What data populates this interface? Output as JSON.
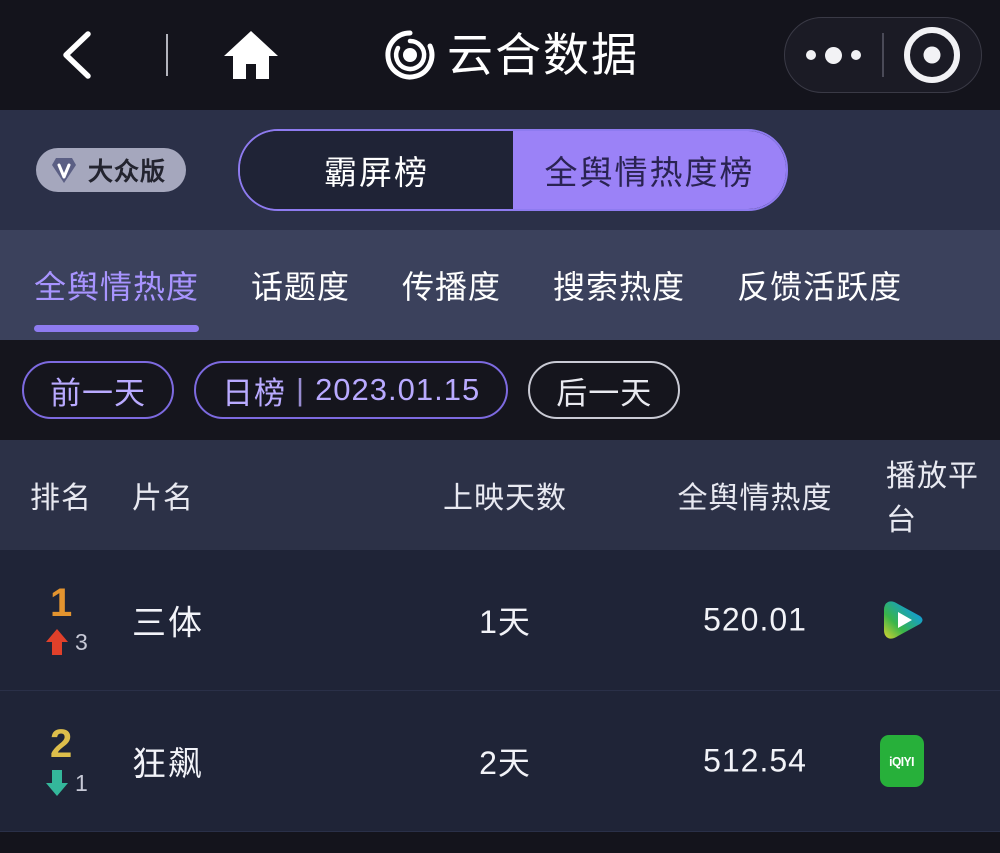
{
  "navbar": {
    "back_icon": "chevron-left-icon",
    "home_icon": "home-icon",
    "logo_icon": "yunhe-swirl-logo-icon",
    "title": "云合数据",
    "capsule": {
      "more_icon": "more-dots-icon",
      "target_icon": "target-ring-icon"
    }
  },
  "version_badge": {
    "icon": "vip-gem-icon",
    "label": "大众版"
  },
  "segmented": {
    "options": [
      {
        "label": "霸屏榜",
        "active": false
      },
      {
        "label": "全舆情热度榜",
        "active": true
      }
    ]
  },
  "tabs": [
    {
      "label": "全舆情热度",
      "active": true
    },
    {
      "label": "话题度",
      "active": false
    },
    {
      "label": "传播度",
      "active": false
    },
    {
      "label": "搜索热度",
      "active": false
    },
    {
      "label": "反馈活跃度",
      "active": false
    }
  ],
  "date_nav": {
    "prev_label": "前一天",
    "period_label": "日榜",
    "separator": "|",
    "date": "2023.01.15",
    "next_label": "后一天"
  },
  "table": {
    "columns": [
      "排名",
      "片名",
      "上映天数",
      "全舆情热度",
      "播放平台"
    ],
    "rows": [
      {
        "rank": "1",
        "rank_color": "#e3942f",
        "trend": "up",
        "trend_icon": "arrow-up-icon",
        "trend_value": "3",
        "trend_color": "#e0402a",
        "title": "三体",
        "days": "1天",
        "heat": "520.01",
        "platform": "youku",
        "platform_icon": "youku-play-icon"
      },
      {
        "rank": "2",
        "rank_color": "#ddbe4b",
        "trend": "down",
        "trend_icon": "arrow-down-icon",
        "trend_value": "1",
        "trend_color": "#34b79b",
        "title": "狂飙",
        "days": "2天",
        "heat": "512.54",
        "platform": "iqiyi",
        "platform_icon": "iqiyi-logo-icon",
        "platform_label": "iQIYI"
      }
    ]
  },
  "colors": {
    "page_background": "#14141c",
    "switch_band": "#2b3048",
    "tab_band": "#3b415c",
    "date_band": "#15151d",
    "table_header": "#2c3147",
    "table_body": "#1f2437",
    "accent_purple": "#8e7bf0",
    "active_segment": "#9b82f7",
    "iqiyi_green": "#27b03a"
  }
}
